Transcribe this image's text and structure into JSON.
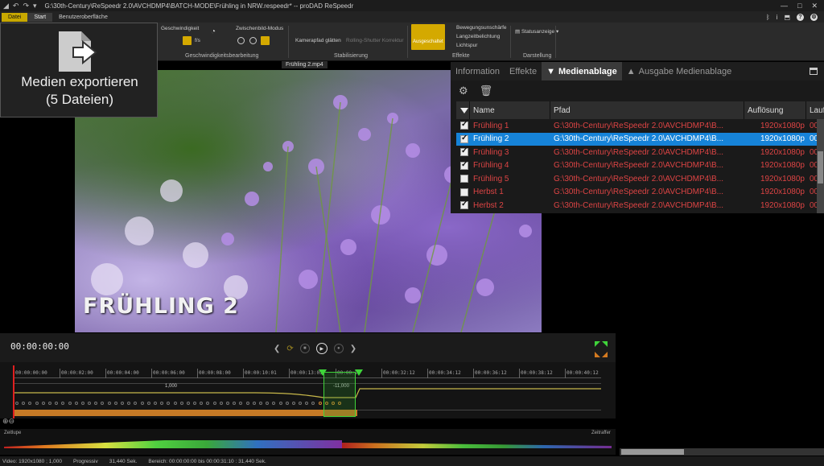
{
  "window": {
    "title": "G:\\30th-Century\\ReSpeedr 2.0\\AVCHDMP4\\BATCH-MODE\\Frühling in NRW.respeedr* -- proDAD ReSpeedr",
    "controls": [
      "—",
      "□",
      "✕"
    ]
  },
  "menubar": {
    "file": "Datei",
    "start": "Start",
    "ui": "Benutzeroberfläche"
  },
  "ribbon": {
    "speed_label": "Geschwindigkeit",
    "fps_unit": "f/s",
    "frame_mode_label": "Zwischenbild-Modus",
    "speed_group": "Geschwindigkeitsbearbeitung",
    "camera_smooth": "Kamerapfad glätten",
    "rolling_shutter": "Rolling-Shutter Korrektur",
    "stabilization_group": "Stabilisierung",
    "off_button": "Ausgeschaltet",
    "effect_motion_blur": "Bewegungsunschärfe",
    "effect_long_exposure": "Langzeitbelichtung",
    "effect_light_trail": "Lichtspur",
    "effects_group": "Effekte",
    "status_display": "Statusanzeige",
    "display_group": "Darstellung"
  },
  "tooltip": {
    "icon": "export-document-icon",
    "line1": "Medien exportieren",
    "line2": "(5 Dateien)"
  },
  "preview": {
    "clip_name": "Frühling 2.mp4",
    "caption": "FRÜHLING 2"
  },
  "panel": {
    "tabs": [
      {
        "label": "Information"
      },
      {
        "label": "Effekte"
      },
      {
        "label": "Medienablage",
        "prefix": "▼",
        "active": true
      },
      {
        "label": "Ausgabe Medienablage",
        "prefix": "▲"
      }
    ],
    "columns": [
      "Name",
      "Pfad",
      "Auflösung",
      "Lauf"
    ],
    "rows": [
      {
        "name": "Frühling 1",
        "path": "G:\\30th-Century\\ReSpeedr 2.0\\AVCHDMP4\\B...",
        "res": "1920x1080p",
        "lauf": "00:0",
        "checked": true,
        "selected": false
      },
      {
        "name": "Frühling 2",
        "path": "G:\\30th-Century\\ReSpeedr 2.0\\AVCHDMP4\\B...",
        "res": "1920x1080p",
        "lauf": "00:0",
        "checked": true,
        "selected": true
      },
      {
        "name": "Frühling 3",
        "path": "G:\\30th-Century\\ReSpeedr 2.0\\AVCHDMP4\\B...",
        "res": "1920x1080p",
        "lauf": "00:0",
        "checked": true,
        "selected": false
      },
      {
        "name": "Frühling 4",
        "path": "G:\\30th-Century\\ReSpeedr 2.0\\AVCHDMP4\\B...",
        "res": "1920x1080p",
        "lauf": "00:0",
        "checked": true,
        "selected": false
      },
      {
        "name": "Frühling 5",
        "path": "G:\\30th-Century\\ReSpeedr 2.0\\AVCHDMP4\\B...",
        "res": "1920x1080p",
        "lauf": "00:0",
        "checked": false,
        "selected": false
      },
      {
        "name": "Herbst 1",
        "path": "G:\\30th-Century\\ReSpeedr 2.0\\AVCHDMP4\\B...",
        "res": "1920x1080p",
        "lauf": "00:0",
        "checked": false,
        "selected": false
      },
      {
        "name": "Herbst 2",
        "path": "G:\\30th-Century\\ReSpeedr 2.0\\AVCHDMP4\\B...",
        "res": "1920x1080p",
        "lauf": "00:0",
        "checked": true,
        "selected": false
      }
    ]
  },
  "transport": {
    "timecode": "00:00:00:00"
  },
  "timeline": {
    "ticks": [
      "00:00:00:00",
      "00:00:02:00",
      "00:00:04:00",
      "00:00:06:00",
      "00:00:08:00",
      "00:00:10:01",
      "00:00:13:05",
      "00:00:21",
      "00:00:32:12",
      "00:00:34:12",
      "00:00:36:12",
      "00:00:38:12",
      "00:00:40:12"
    ],
    "value_left": "1,000",
    "value_right": "-11,000"
  },
  "speedbar": {
    "left_label": "Zeitlupe",
    "right_label": "Zeitraffer"
  },
  "status": {
    "video": "Video: 1920x1080 ; 1,000",
    "mode": "Progressiv",
    "duration": "31,440 Sek.",
    "range": "Bereich: 00:00:00:00 bis 00:00:31:10 : 31,440 Sek."
  },
  "colors": {
    "accent_yellow": "#d4a900",
    "selection_blue": "#1683d8",
    "row_red": "#dd4444",
    "timeline_green": "#3fd43a"
  }
}
